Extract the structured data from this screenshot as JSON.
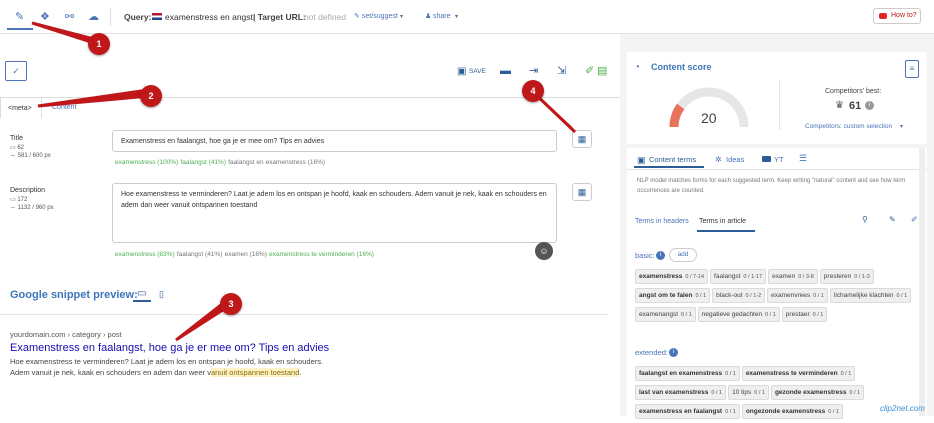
{
  "toolbar": {
    "query_label": "Query:",
    "query_value": "examenstress en angst",
    "target_label": "| Target URL:",
    "target_value": "not defined",
    "set_suggest": "set/suggest",
    "share": "share",
    "how_to": "How to?"
  },
  "editor": {
    "save": "SAVE",
    "tab_meta": "<meta>",
    "tab_content": "Content",
    "title": {
      "label": "Title",
      "chars": "62",
      "px": "581 / 600 px",
      "value": "Examenstress en faalangst, hoe ga je er mee om? Tips en advies",
      "kw1": "examenstress (100%)",
      "kw2": "faalangst (41%)",
      "kw3": "faalangst en examenstress (16%)"
    },
    "description": {
      "label": "Description",
      "chars": "172",
      "px": "1132 / 960 px",
      "value": "Hoe examenstress te verminderen? Laat je adem los en ontspan je hoofd, kaak en schouders. Adem vanuit je nek, kaak en schouders en adem dan weer vanuit ontspannen toestand",
      "kw1": "examenstress (83%)",
      "kw2": "faalangst (41%)",
      "kw3": "examen (16%)",
      "kw4": "examenstress te verminderen (16%)"
    },
    "snippet": {
      "heading": "Google snippet preview:",
      "url": "yourdomain.com › category › post",
      "title": "Examenstress en faalangst, hoe ga je er mee om? Tips en advies",
      "desc_line1": "Hoe examenstress te verminderen? Laat je adem los en ontspan je hoofd, kaak en schouders.",
      "desc_line2_a": "Adem vanuit je nek, kaak en schouders en adem dan weer v",
      "desc_line2_b": "anuit ontspannen toestand",
      "desc_line2_c": "."
    }
  },
  "score": {
    "title": "Content score",
    "value": "20",
    "value_fraction": 0.2,
    "competitors_best_label": "Competitors' best:",
    "competitors_best": "61",
    "competitors_select": "Competitors: custom selection"
  },
  "panel": {
    "tab_content_terms": "Content terms",
    "tab_ideas": "Ideas",
    "tab_yt": "YT",
    "info": "NLP model matches forms for each suggested term. Keep writing \"natural\" content and see how term occurrences are counted.",
    "sub_headers": "Terms in headers",
    "sub_article": "Terms in article",
    "basic_label": "basic:",
    "add": "add",
    "extended_label": "extended:",
    "basic_terms": [
      {
        "t": "examenstress",
        "c": "0 / 7-14",
        "b": true
      },
      {
        "t": "faalangst",
        "c": "0 / 1-17"
      },
      {
        "t": "examen",
        "c": "0 / 3-8"
      },
      {
        "t": "presteren",
        "c": "0 / 1-3"
      },
      {
        "t": "angst om te falen",
        "c": "0 / 1",
        "b": true
      },
      {
        "t": "black-out",
        "c": "0 / 1-2"
      },
      {
        "t": "examenvrees",
        "c": "0 / 1"
      },
      {
        "t": "lichamelijke klachten",
        "c": "0 / 1"
      },
      {
        "t": "examenangst",
        "c": "0 / 1"
      },
      {
        "t": "negatieve gedachten",
        "c": "0 / 1"
      },
      {
        "t": "prestaer",
        "c": "0 / 1"
      }
    ],
    "extended_terms": [
      {
        "t": "faalangst en examenstress",
        "c": "0 / 1",
        "b": true
      },
      {
        "t": "examenstress te verminderen",
        "c": "0 / 1",
        "b": true
      },
      {
        "t": "last van examenstress",
        "c": "0 / 1",
        "b": true
      },
      {
        "t": "10 tips",
        "c": "0 / 1"
      },
      {
        "t": "gezonde examenstress",
        "c": "0 / 1",
        "b": true
      },
      {
        "t": "examenstress en faalangst",
        "c": "0 / 1",
        "b": true
      },
      {
        "t": "ongezonde examenstress",
        "c": "0 / 1",
        "b": true
      }
    ]
  },
  "annotations": [
    "1",
    "2",
    "3",
    "4"
  ],
  "watermark": "clip2net.com",
  "colors": {
    "accent": "#4a73b8",
    "annotation": "#c0171b",
    "gauge": "#e8725c"
  }
}
